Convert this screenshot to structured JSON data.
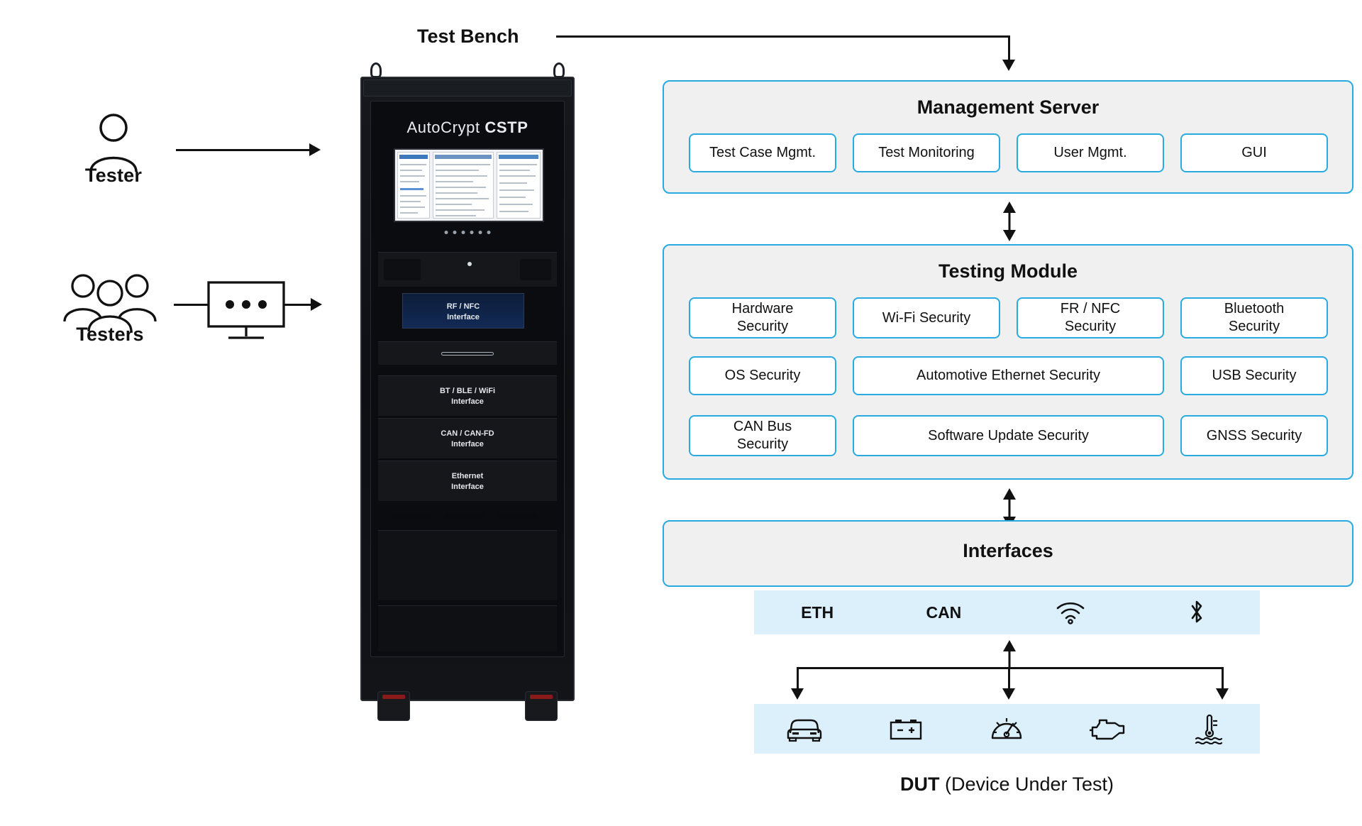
{
  "diagram": {
    "bench_label": "Test Bench",
    "actors": [
      {
        "label": "Tester",
        "icon": "single-person-icon"
      },
      {
        "label": "Testers",
        "icon": "group-of-people-icon"
      }
    ],
    "workstation_icon": "monitor-icon"
  },
  "rack": {
    "brand_light": "AutoCrypt ",
    "brand_bold": "CSTP",
    "modules": [
      {
        "line1": "RF / NFC",
        "line2": "Interface"
      },
      {
        "line1": "BT / BLE / WiFi",
        "line2": "Interface"
      },
      {
        "line1": "CAN / CAN-FD",
        "line2": "Interface"
      },
      {
        "line1": "Ethernet",
        "line2": "Interface"
      }
    ]
  },
  "management_server": {
    "title": "Management Server",
    "items": [
      "Test Case Mgmt.",
      "Test Monitoring",
      "User Mgmt.",
      "GUI"
    ]
  },
  "testing_module": {
    "title": "Testing Module",
    "row1": [
      "Hardware\nSecurity",
      "Wi-Fi Security",
      "FR / NFC\nSecurity",
      "Bluetooth\nSecurity"
    ],
    "row2": [
      "OS Security",
      "Automotive Ethernet Security",
      "USB Security"
    ],
    "row3": [
      "CAN Bus\nSecurity",
      "Software Update Security",
      "GNSS Security"
    ]
  },
  "interfaces": {
    "title": "Interfaces",
    "bus_strip": [
      {
        "label": "ETH",
        "icon": "text-eth"
      },
      {
        "label": "CAN",
        "icon": "text-can"
      },
      {
        "label": "",
        "icon": "wifi-icon"
      },
      {
        "label": "",
        "icon": "bluetooth-icon"
      }
    ]
  },
  "dut": {
    "caption_bold": "DUT",
    "caption_rest": " (Device Under Test)",
    "icons": [
      "car-icon",
      "battery-icon",
      "speedometer-icon",
      "engine-icon",
      "coolant-temperature-icon"
    ]
  },
  "colors": {
    "accent_border": "#29abe2",
    "panel_fill": "#f0f0f0",
    "strip_fill": "#dcf0fb",
    "text": "#111111"
  }
}
